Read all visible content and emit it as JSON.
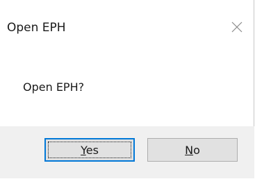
{
  "window": {
    "title": "Open EPH",
    "close_icon": "close-icon"
  },
  "message": "Open EPH?",
  "buttons": {
    "yes": {
      "mnemonic": "Y",
      "rest": "es",
      "is_default": true
    },
    "no": {
      "mnemonic": "N",
      "rest": "o"
    }
  },
  "colors": {
    "footer_bg": "#f0f0f0",
    "button_bg": "#e1e1e1",
    "default_button_border": "#0078d7"
  }
}
